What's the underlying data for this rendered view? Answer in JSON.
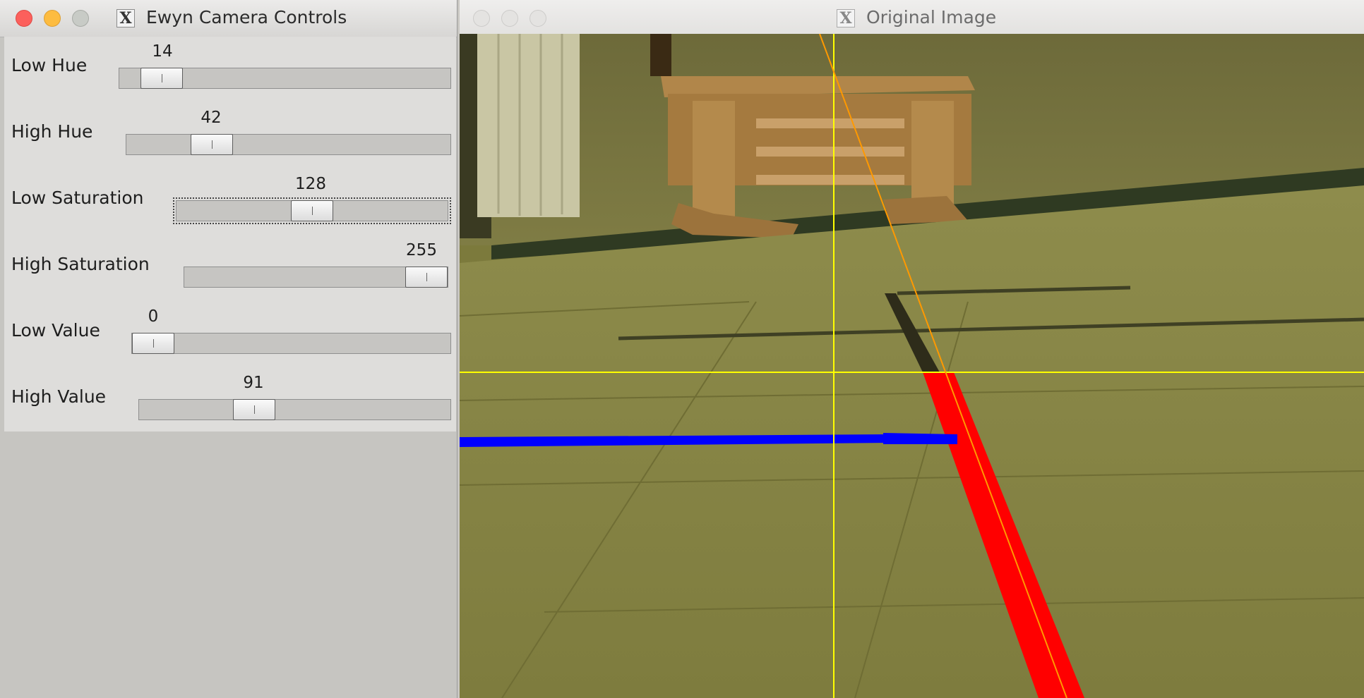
{
  "controls_window": {
    "title": "Ewyn Camera Controls",
    "x_icon_glyph": "X",
    "sliders": [
      {
        "label": "Low Hue",
        "value": "14",
        "max": 179
      },
      {
        "label": "High Hue",
        "value": "42",
        "max": 179
      },
      {
        "label": "Low Saturation",
        "value": "128",
        "max": 255
      },
      {
        "label": "High Saturation",
        "value": "255",
        "max": 255
      },
      {
        "label": "Low Value",
        "value": "0",
        "max": 255
      },
      {
        "label": "High Value",
        "value": "91",
        "max": 255
      }
    ]
  },
  "image_window": {
    "title": "Original Image",
    "x_icon_glyph": "X"
  },
  "colors": {
    "floor": "#85833f",
    "detected_line": "#ff0000",
    "horizontal_marker": "#0000ff",
    "crosshair": "#ffff00",
    "trajectory": "#ff9900"
  }
}
